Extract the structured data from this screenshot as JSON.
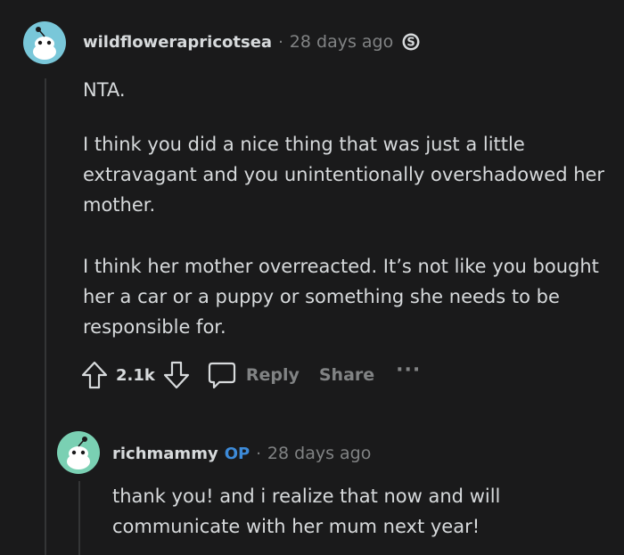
{
  "comment1": {
    "username": "wildflowerapricotsea",
    "separator": "·",
    "time": "28 days ago",
    "paragraphs": [
      "NTA.",
      "I think you did a nice thing that was just a little extravagant and you unintentionally overshadowed her mother.",
      "I think her mother overreacted. It’s not like you bought her a car or a puppy or something she needs to be responsible for."
    ],
    "score": "2.1k",
    "reply_label": "Reply",
    "share_label": "Share",
    "more_label": "···"
  },
  "comment2": {
    "username": "richmammy",
    "op_badge": "OP",
    "separator": "·",
    "time": "28 days ago",
    "paragraphs": [
      "thank you! and i realize that now and will communicate with her mum next year!"
    ]
  },
  "colors": {
    "background": "#1a1a1b",
    "text": "#d7dadc",
    "muted": "#818384",
    "op_badge": "#3d8bd9",
    "avatar1": "#79c7d9",
    "avatar2": "#7ad0b3"
  },
  "icons": [
    "snoo-avatar-icon",
    "award-icon",
    "upvote-icon",
    "downvote-icon",
    "comment-bubble-icon"
  ]
}
